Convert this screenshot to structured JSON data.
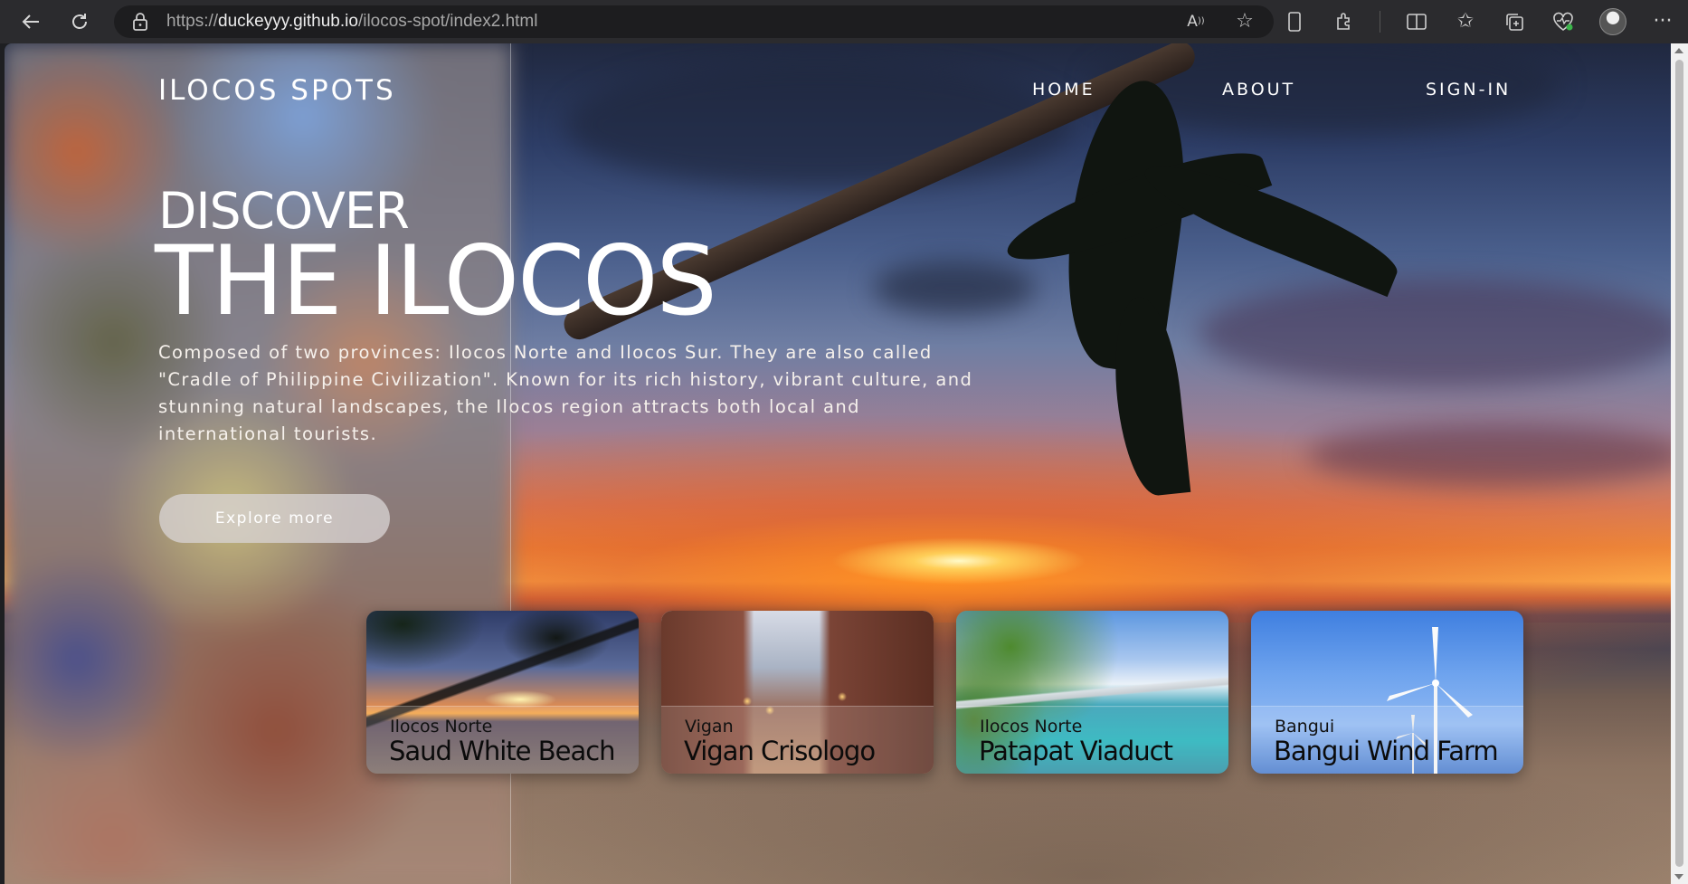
{
  "browser": {
    "url_prefix": "https://",
    "url_domain": "duckeyyy.github.io",
    "url_path": "/ilocos-spot/index2.html",
    "read_aloud_icon": "read-aloud-icon",
    "favorite_icon": "star-icon"
  },
  "nav": {
    "logo": "ILOCOS SPOTS",
    "items": [
      {
        "label": "HOME"
      },
      {
        "label": "ABOUT"
      },
      {
        "label": "SIGN-IN"
      }
    ]
  },
  "hero": {
    "eyebrow": "DISCOVER",
    "title": "THE ILOCOS",
    "description": "Composed of two provinces: Ilocos Norte and Ilocos Sur. They are also called \"Cradle of Philippine Civilization\". Known for its rich history, vibrant culture, and stunning natural landscapes, the Ilocos region attracts both local and international tourists.",
    "button": "Explore more"
  },
  "cards": [
    {
      "location": "Ilocos Norte",
      "name": "Saud White Beach"
    },
    {
      "location": "Vigan",
      "name": "Vigan Crisologo"
    },
    {
      "location": "Ilocos Norte",
      "name": "Patapat Viaduct"
    },
    {
      "location": "Bangui",
      "name": "Bangui Wind Farm"
    }
  ]
}
